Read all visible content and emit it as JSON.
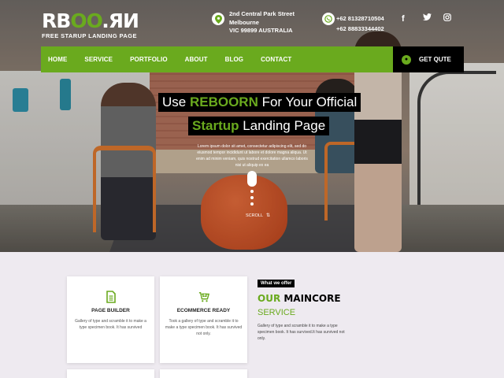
{
  "brand": {
    "logo_text_part1": "RB",
    "logo_text_part2": "OO",
    "logo_text_part3": ".ЯИ",
    "tagline": "FREE STARUP LANDING PAGE",
    "accent_color": "#6aaa1e"
  },
  "header": {
    "address_line1": "2nd  Central Park Street",
    "address_line2": "Melbourne",
    "address_line3": "VIC 99899 AUSTRALIA",
    "phone1": "+62 81328710504",
    "phone2": "+62 88833344402",
    "social": [
      "facebook-icon",
      "twitter-icon",
      "instagram-icon"
    ]
  },
  "nav": {
    "items": [
      "HOME",
      "SERVICE",
      "PORTFOLIO",
      "ABOUT",
      "BLOG",
      "CONTACT"
    ],
    "quote_label": "GET QUTE"
  },
  "hero": {
    "line1_pre": "Use ",
    "line1_highlight": "REBOORN",
    "line1_post": " For Your Official",
    "line2_highlight": "Startup",
    "line2_post": " Landing Page",
    "paragraph": "Lorem ipsum dolor sit amet, consectetur adipiscing elit, sed do eiusmod tempor incididunt ut labore et dolore magna aliqua. Ut enim ad minim veniam, quis nostrud exercitation ullamco laboris nisi ut aliquip ex ea",
    "scroll_label": "SCROLL"
  },
  "features": {
    "cards": [
      {
        "icon": "document-icon",
        "title": "PAGE BUILDER",
        "desc": "Gallery of type and scramble it to make a type specimen book. It has survived"
      },
      {
        "icon": "cart-icon",
        "title": "ECOMMERCE READY",
        "desc": "Took a gallery of type and scramble it to make a type specimen book. It has survived not only."
      }
    ],
    "badge": "What we offer",
    "heading_green": "OUR",
    "heading_rest": " MAINCORE",
    "subheading": "SERVICE",
    "paragraph": "Gallery of type and scramble it to make a type specimen book. It has survived.It has survived not only."
  }
}
